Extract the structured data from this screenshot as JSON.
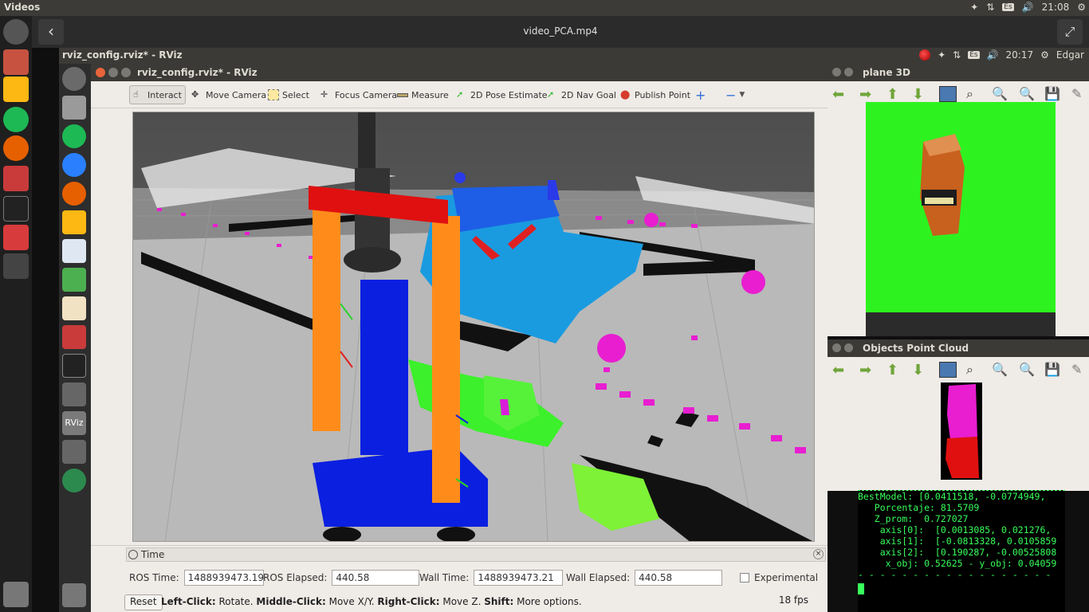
{
  "host": {
    "app_name": "Videos",
    "keyboard_layout": "Es",
    "clock": "21:08",
    "window_title": "video_PCA.mp4"
  },
  "inner": {
    "window_title": "rviz_config.rviz* - RViz",
    "keyboard_layout": "Es",
    "clock": "20:17",
    "user": "Edgar"
  },
  "rviz": {
    "title": "rviz_config.rviz* - RViz",
    "tools": [
      {
        "label": "Interact"
      },
      {
        "label": "Move Camera"
      },
      {
        "label": "Select"
      },
      {
        "label": "Focus Camera"
      },
      {
        "label": "Measure"
      },
      {
        "label": "2D Pose Estimate"
      },
      {
        "label": "2D Nav Goal"
      },
      {
        "label": "Publish Point"
      }
    ],
    "time": {
      "header": "Time",
      "ros_time_label": "ROS Time:",
      "ros_time": "1488939473.19",
      "ros_elapsed_label": "ROS Elapsed:",
      "ros_elapsed": "440.58",
      "wall_time_label": "Wall Time:",
      "wall_time": "1488939473.21",
      "wall_elapsed_label": "Wall Elapsed:",
      "wall_elapsed": "440.58",
      "experimental_label": "Experimental"
    },
    "status": {
      "reset_label": "Reset",
      "hint_left": "Left-Click:",
      "hint_left_text": " Rotate. ",
      "hint_middle": "Middle-Click:",
      "hint_middle_text": " Move X/Y. ",
      "hint_right": "Right-Click:",
      "hint_right_text": " Move Z. ",
      "hint_shift": "Shift:",
      "hint_shift_text": " More options.",
      "fps": "18 fps"
    }
  },
  "plane3d": {
    "title": "plane 3D"
  },
  "objects_cloud": {
    "title": "Objects Point Cloud"
  },
  "terminal": {
    "lines": [
      "BestModel: [0.0411518, -0.0774949,",
      "   Porcentaje: 81.5709",
      "   Z_prom:  0.727027",
      "    axis[0]:  [0.0013085, 0.021276,",
      "    axis[1]:  [-0.0813328, 0.0105859",
      "    axis[2]:  [0.190287, -0.00525808",
      "     x_obj: 0.52625 - y_obj: 0.04059",
      "- - - - - - - - - - - - - - - - - -"
    ]
  },
  "colors": {
    "ubuntu_panel": "#3c3b37",
    "terminal_green": "#37ff5b",
    "green_screen": "#2ef21f",
    "point_magenta": "#e81ed0",
    "robot_blue": "#0a1fe0",
    "robot_orange": "#ff8c1a"
  }
}
